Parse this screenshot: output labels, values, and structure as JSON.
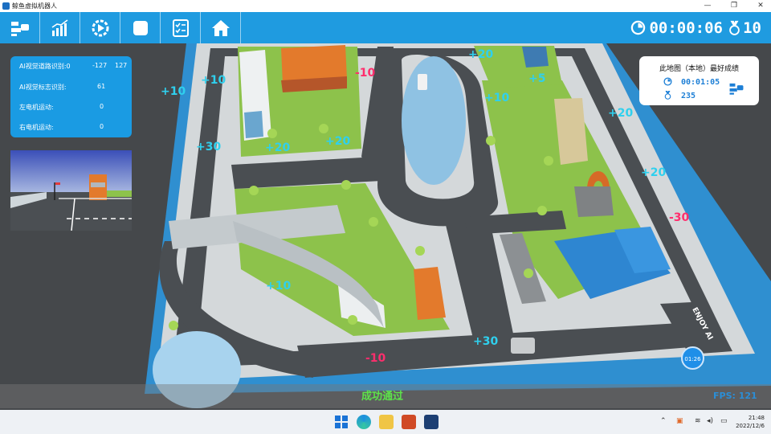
{
  "window": {
    "title": "鲸鱼虚拟机器人",
    "controls": [
      "—",
      "❐",
      "✕"
    ]
  },
  "toolbar": {
    "buttons": [
      {
        "name": "robot-config",
        "icon": "robot-config-icon"
      },
      {
        "name": "statistics",
        "icon": "bar-chart-icon"
      },
      {
        "name": "run",
        "icon": "play-gear-icon"
      },
      {
        "name": "stop",
        "icon": "stop-icon"
      },
      {
        "name": "task-list",
        "icon": "checklist-icon"
      },
      {
        "name": "home",
        "icon": "home-icon"
      }
    ],
    "timer": "00:00:06",
    "score": "10",
    "accent": "#1f9be0"
  },
  "status_panel": {
    "rows": [
      {
        "label": "AI视觉道路识别:0",
        "value": "-127",
        "value2": "127"
      },
      {
        "label": "AI视觉标志识别:",
        "value": "61"
      },
      {
        "label": "左电机运动:",
        "value": "0"
      },
      {
        "label": "右电机运动:",
        "value": "0"
      }
    ]
  },
  "best_record": {
    "title": "此地图（本地）最好成绩",
    "time": "00:01:05",
    "score": "235"
  },
  "map_markers": [
    {
      "text": "+10",
      "color": "#2fd0ee"
    },
    {
      "text": "-10",
      "color": "#ff2e6d"
    },
    {
      "text": "+20",
      "color": "#2fd0ee"
    },
    {
      "text": "+5",
      "color": "#2fd0ee"
    },
    {
      "text": "+10",
      "color": "#2fd0ee"
    },
    {
      "text": "+20",
      "color": "#2fd0ee"
    },
    {
      "text": "+20",
      "color": "#2fd0ee"
    },
    {
      "text": "+30",
      "color": "#2fd0ee"
    },
    {
      "text": "+20",
      "color": "#2fd0ee"
    },
    {
      "text": "+10",
      "color": "#2fd0ee"
    },
    {
      "text": "+20",
      "color": "#2fd0ee"
    },
    {
      "text": "-30",
      "color": "#ff2e6d"
    },
    {
      "text": "+10",
      "color": "#2fd0ee"
    },
    {
      "text": "+30",
      "color": "#2fd0ee"
    },
    {
      "text": "-10",
      "color": "#ff2e6d"
    }
  ],
  "logo_text": "ENJOY AI",
  "pass_text": "成功通过",
  "fps_text": "FPS: 121",
  "countdown": "01:26",
  "taskbar": {
    "time": "21:48",
    "date": "2022/12/6"
  }
}
